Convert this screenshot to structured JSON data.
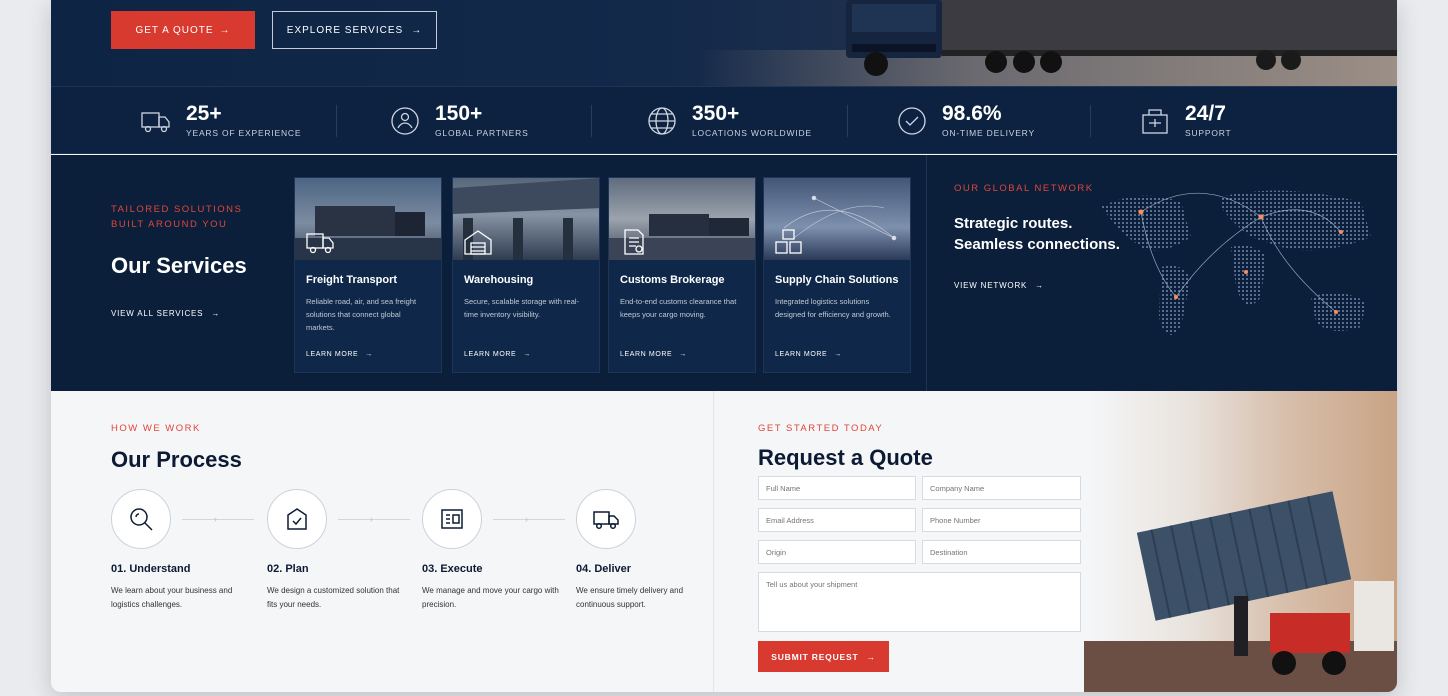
{
  "hero": {
    "quote_button": "GET A QUOTE",
    "services_button": "EXPLORE SERVICES",
    "arrow": "→"
  },
  "stats": [
    {
      "value": "25+",
      "label": "YEARS OF EXPERIENCE",
      "icon": "truck-icon"
    },
    {
      "value": "150+",
      "label": "GLOBAL PARTNERS",
      "icon": "partners-icon"
    },
    {
      "value": "350+",
      "label": "LOCATIONS WORLDWIDE",
      "icon": "globe-icon"
    },
    {
      "value": "98.6%",
      "label": "ON-TIME DELIVERY",
      "icon": "check-clock-icon"
    },
    {
      "value": "24/7",
      "label": "SUPPORT",
      "icon": "support-icon"
    }
  ],
  "services": {
    "eyebrow_line1": "TAILORED SOLUTIONS",
    "eyebrow_line2": "BUILT AROUND YOU",
    "title": "Our Services",
    "view_all": "VIEW ALL SERVICES",
    "cards": [
      {
        "title": "Freight Transport",
        "desc": "Reliable road, air, and sea freight solutions that connect global markets.",
        "more": "LEARN MORE"
      },
      {
        "title": "Warehousing",
        "desc": "Secure, scalable storage with real-time inventory visibility.",
        "more": "LEARN MORE"
      },
      {
        "title": "Customs Brokerage",
        "desc": "End-to-end customs clearance that keeps your cargo moving.",
        "more": "LEARN MORE"
      },
      {
        "title": "Supply Chain Solutions",
        "desc": "Integrated logistics solutions designed for efficiency and growth.",
        "more": "LEARN MORE"
      }
    ]
  },
  "network": {
    "eyebrow": "OUR GLOBAL NETWORK",
    "line1": "Strategic routes.",
    "line2": "Seamless connections.",
    "link": "VIEW NETWORK"
  },
  "process": {
    "eyebrow": "HOW WE WORK",
    "title": "Our Process",
    "steps": [
      {
        "title": "01. Understand",
        "desc": "We learn about your business and logistics challenges."
      },
      {
        "title": "02. Plan",
        "desc": "We design a customized solution that fits your needs."
      },
      {
        "title": "03. Execute",
        "desc": "We manage and move your cargo with precision."
      },
      {
        "title": "04. Deliver",
        "desc": "We ensure timely delivery and continuous support."
      }
    ]
  },
  "quote": {
    "eyebrow": "GET STARTED TODAY",
    "title": "Request a Quote",
    "full_name": "Full Name",
    "company": "Company Name",
    "email": "Email Address",
    "phone": "Phone Number",
    "origin": "Origin",
    "destination": "Destination",
    "message": "Tell us about your shipment",
    "submit": "SUBMIT REQUEST"
  },
  "colors": {
    "accent": "#d93a30",
    "navy": "#0b1f3b"
  }
}
